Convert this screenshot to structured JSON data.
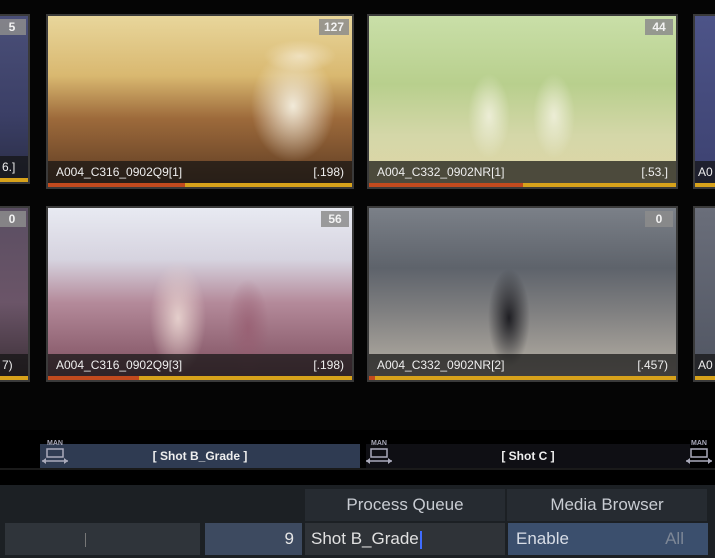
{
  "clips": [
    {
      "name": "A004_C316_0902Q9[1]",
      "value": "[.198)",
      "count": "127",
      "progress": 0.45
    },
    {
      "name": "A004_C332_0902NR[1]",
      "value": "[.53.]",
      "count": "44",
      "progress": 0.5
    },
    {
      "name": "A004_C316_0902Q9[3]",
      "value": "[.198)",
      "count": "56",
      "progress": 0.3
    },
    {
      "name": "A004_C332_0902NR[2]",
      "value": "[.457)",
      "count": "0",
      "progress": 0.02
    }
  ],
  "edge_clips": {
    "left_top_count": "5",
    "left_top_value": "6.]",
    "left_bottom_count": "0",
    "left_bottom_value": "7)",
    "right_top_label": "A0",
    "right_bottom_label": "A0"
  },
  "timeline": {
    "man_label": "MAN",
    "segments": [
      {
        "label": "[ Shot B_Grade ]"
      },
      {
        "label": "[ Shot C ]"
      }
    ]
  },
  "panel": {
    "tabs": {
      "process_queue": "Process Queue",
      "media_browser": "Media Browser"
    },
    "number_value": "9",
    "shot_name": "Shot B_Grade",
    "enable_label": "Enable",
    "all_label": "All"
  }
}
